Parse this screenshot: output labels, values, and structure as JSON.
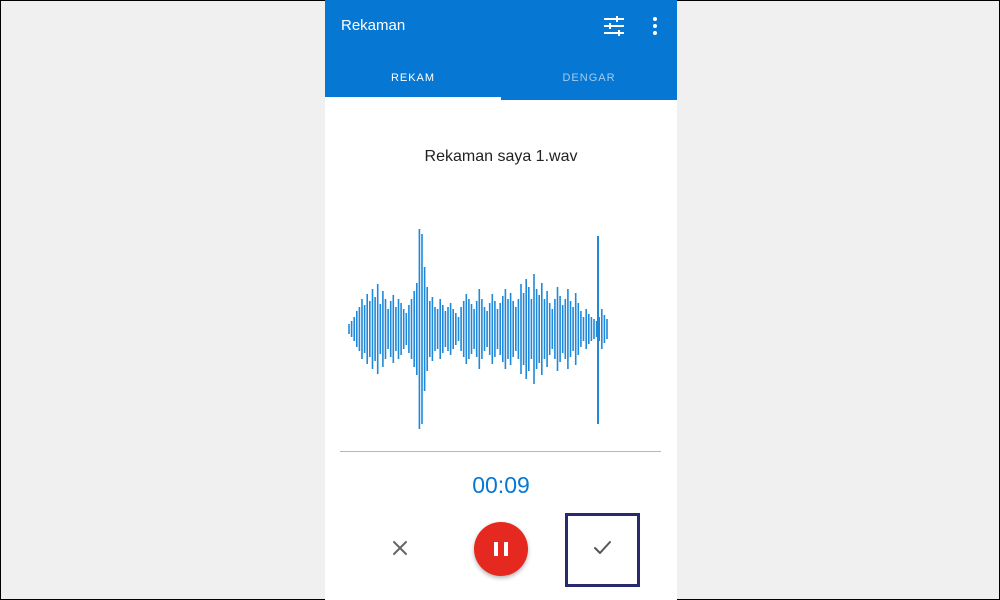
{
  "app": {
    "title": "Rekaman",
    "actions": [
      {
        "icon": "settings-sliders-icon"
      },
      {
        "icon": "more-vertical-icon"
      }
    ],
    "accent_color": "#0677d3"
  },
  "tabs": [
    {
      "label": "REKAM",
      "active": true
    },
    {
      "label": "DENGAR",
      "active": false
    }
  ],
  "recording": {
    "file_name": "Rekaman saya 1.wav",
    "elapsed": "00:09",
    "waveform_color": "#1f88d9",
    "waveform_levels": [
      0.05,
      0.08,
      0.12,
      0.18,
      0.22,
      0.3,
      0.24,
      0.35,
      0.28,
      0.4,
      0.32,
      0.45,
      0.25,
      0.38,
      0.3,
      0.2,
      0.28,
      0.34,
      0.22,
      0.3,
      0.26,
      0.2,
      0.16,
      0.24,
      0.3,
      0.38,
      0.46,
      1.0,
      0.95,
      0.62,
      0.42,
      0.28,
      0.32,
      0.22,
      0.2,
      0.3,
      0.24,
      0.18,
      0.22,
      0.26,
      0.2,
      0.16,
      0.12,
      0.22,
      0.28,
      0.35,
      0.3,
      0.25,
      0.2,
      0.28,
      0.4,
      0.3,
      0.22,
      0.18,
      0.26,
      0.35,
      0.28,
      0.2,
      0.26,
      0.33,
      0.4,
      0.3,
      0.36,
      0.28,
      0.22,
      0.3,
      0.45,
      0.36,
      0.5,
      0.42,
      0.3,
      0.55,
      0.4,
      0.34,
      0.46,
      0.3,
      0.38,
      0.26,
      0.2,
      0.3,
      0.42,
      0.33,
      0.24,
      0.3,
      0.4,
      0.28,
      0.22,
      0.36,
      0.26,
      0.18,
      0.12,
      0.2,
      0.15,
      0.12,
      0.1,
      0.08,
      0.12,
      0.2,
      0.14,
      0.1
    ]
  },
  "controls": {
    "cancel": {
      "icon": "close-icon"
    },
    "pause": {
      "icon": "pause-icon",
      "color": "#e52920"
    },
    "confirm": {
      "icon": "check-icon"
    }
  },
  "annotation": {
    "highlight_color": "#29296d"
  }
}
